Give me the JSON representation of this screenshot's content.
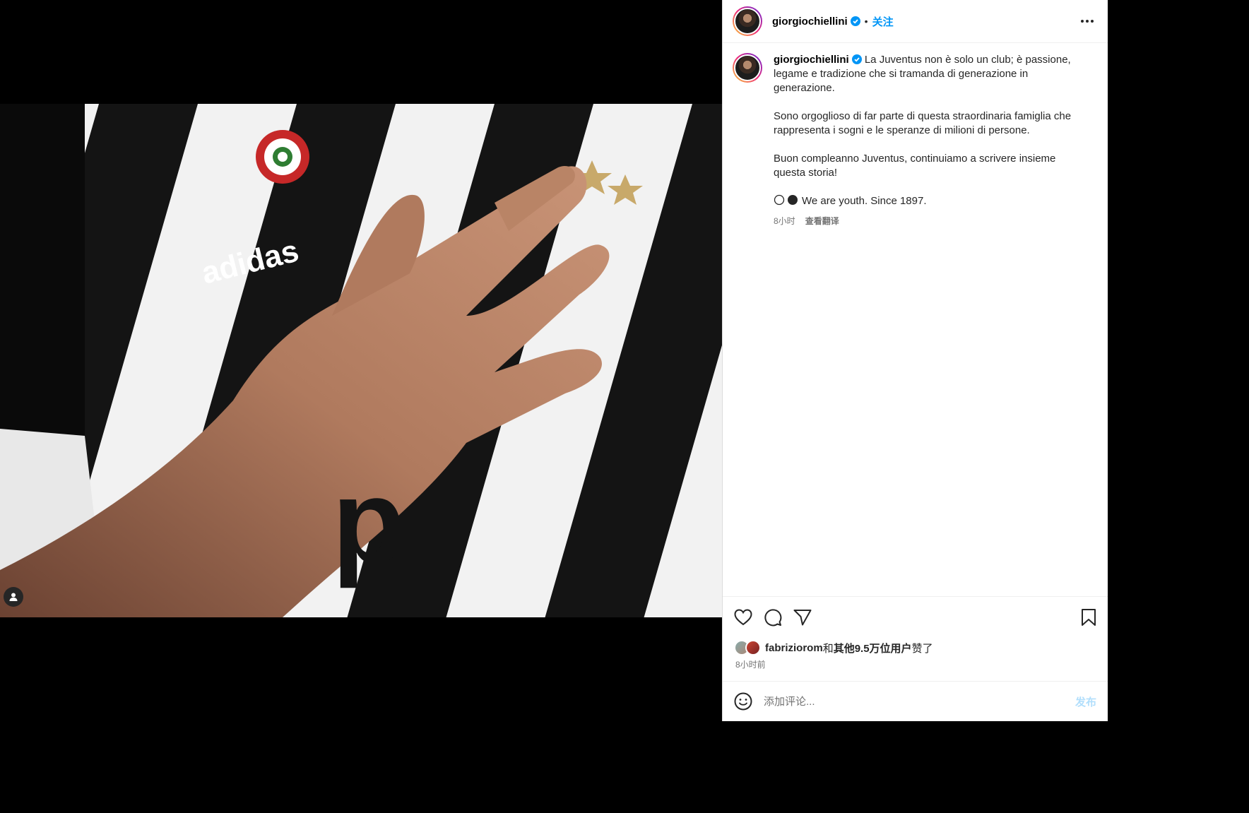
{
  "post": {
    "username": "giorgiochiellini",
    "dot": "•",
    "follow_label": "关注",
    "caption_line1": "La Juventus non è solo un club; è passione, legame e tradizione che si tramanda di generazione in generazione.",
    "caption_para2": "Sono orgoglioso di far parte di questa straordinaria famiglia che rappresenta i sogni e le speranze di milioni di persone.",
    "caption_para3": "Buon compleanno Juventus, continuiamo a scrivere insieme questa storia!",
    "caption_para4": "We are youth. Since 1897.",
    "caption_time": "8小时",
    "translate_label": "查看翻译"
  },
  "likes": {
    "user": "fabriziorom",
    "and": "和",
    "others": "其他9.5万位用户",
    "suffix": "赞了",
    "time": "8小时前"
  },
  "comment": {
    "placeholder": "添加评论...",
    "post_label": "发布"
  },
  "icons": [
    "verified-badge-icon",
    "more-options-icon",
    "heart-icon",
    "comment-icon",
    "share-icon",
    "bookmark-icon",
    "emoji-icon",
    "user-tag-icon"
  ],
  "colors": {
    "accent": "#0095f6",
    "post_disabled": "#b2dffc",
    "muted": "#737373"
  }
}
